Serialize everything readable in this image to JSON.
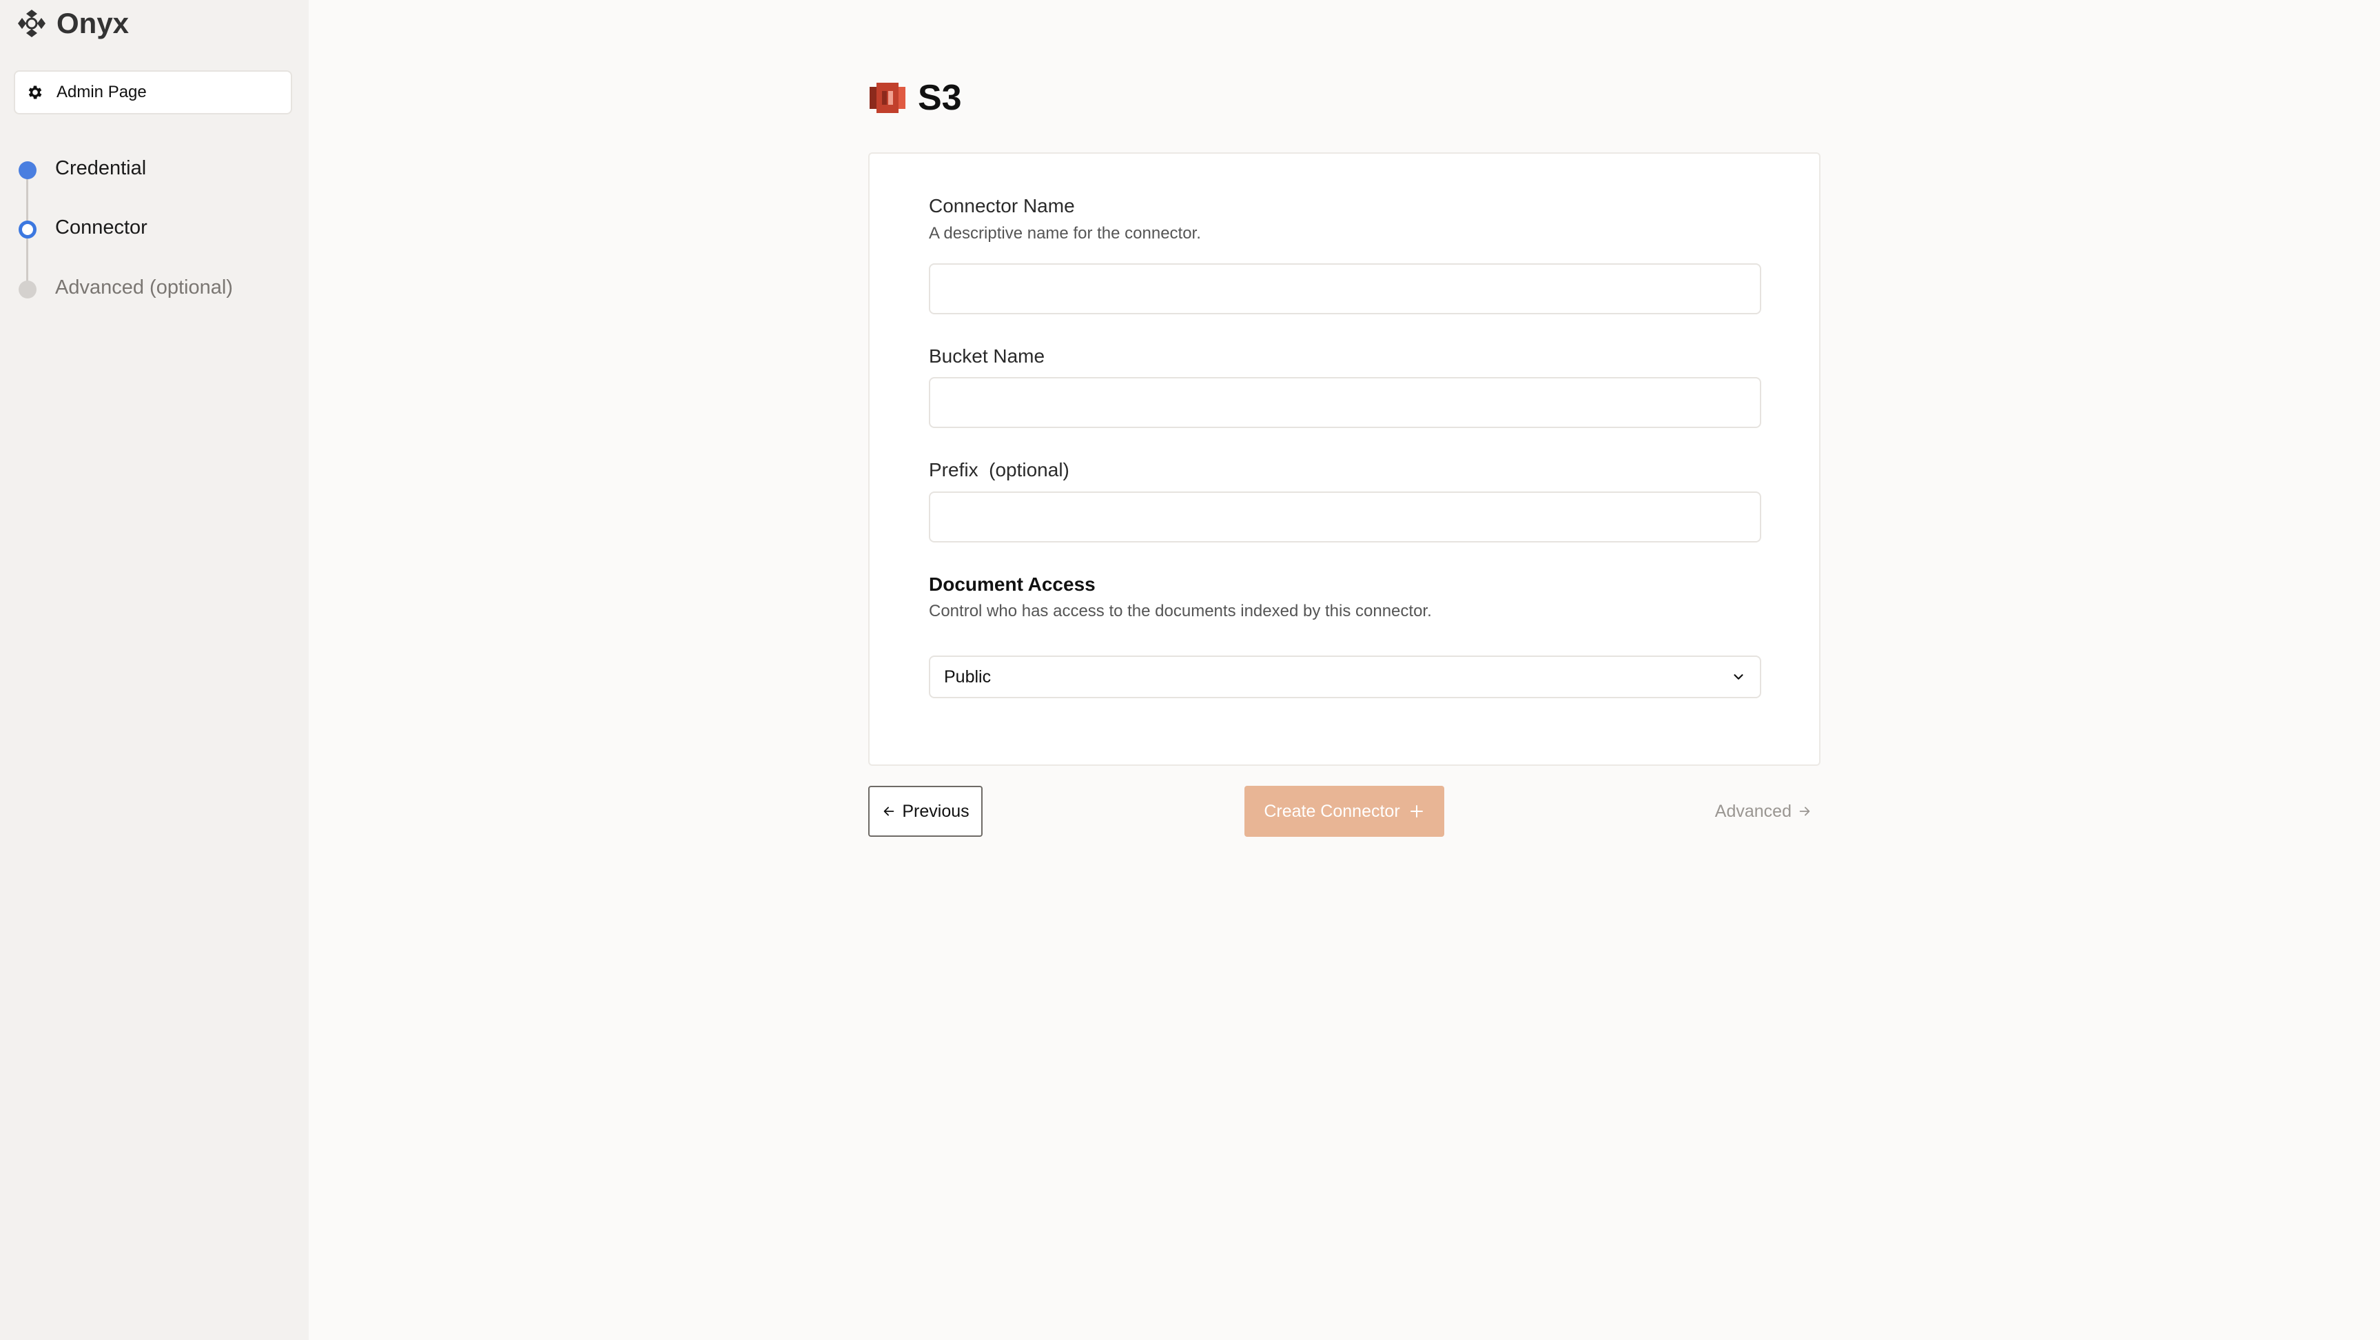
{
  "app": {
    "name": "Onyx",
    "admin_button_label": "Admin Page"
  },
  "steps": [
    {
      "label": "Credential",
      "state": "complete"
    },
    {
      "label": "Connector",
      "state": "current"
    },
    {
      "label": "Advanced (optional)",
      "state": "pending"
    }
  ],
  "page": {
    "title": "S3",
    "title_icon": "aws-s3-icon"
  },
  "form": {
    "connector_name": {
      "label": "Connector Name",
      "description": "A descriptive name for the connector.",
      "value": ""
    },
    "bucket_name": {
      "label": "Bucket Name",
      "value": ""
    },
    "prefix": {
      "label": "Prefix",
      "optional_label": "(optional)",
      "value": ""
    },
    "document_access": {
      "label": "Document Access",
      "description": "Control who has access to the documents indexed by this connector.",
      "selected": "Public"
    }
  },
  "actions": {
    "previous_label": "Previous",
    "create_label": "Create Connector",
    "advanced_label": "Advanced"
  },
  "colors": {
    "accent_blue": "#3c78e0",
    "create_button": "#e8b595",
    "s3_red": "#c1402c"
  }
}
